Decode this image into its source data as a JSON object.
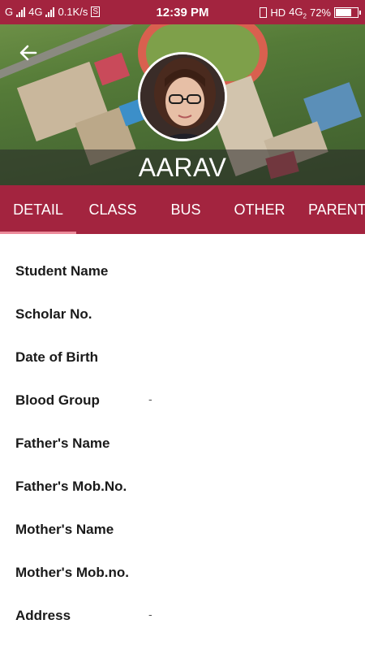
{
  "status_bar": {
    "carrier_left": "G",
    "network_left": "4G",
    "speed": "0.1K/s",
    "sim_badge": "S",
    "time": "12:39 PM",
    "hd": "HD",
    "network_right": "4G",
    "network_right_sub": "2",
    "battery_percent": "72%",
    "battery_level": 0.72
  },
  "header": {
    "student_name": "AARAV",
    "back_icon": "arrow-left-icon"
  },
  "tabs": [
    {
      "label": "DETAIL",
      "active": true
    },
    {
      "label": "CLASS",
      "active": false
    },
    {
      "label": "BUS",
      "active": false
    },
    {
      "label": "OTHER",
      "active": false
    },
    {
      "label": "PARENT",
      "active": false
    }
  ],
  "details": [
    {
      "label": "Student Name",
      "value": ""
    },
    {
      "label": "Scholar No.",
      "value": ""
    },
    {
      "label": "Date of Birth",
      "value": ""
    },
    {
      "label": "Blood Group",
      "value": "-"
    },
    {
      "label": "Father's Name",
      "value": ""
    },
    {
      "label": "Father's Mob.No.",
      "value": ""
    },
    {
      "label": "Mother's Name",
      "value": ""
    },
    {
      "label": "Mother's Mob.no.",
      "value": ""
    },
    {
      "label": "Address",
      "value": "-"
    }
  ],
  "colors": {
    "primary": "#a3243f",
    "tab_indicator": "#ec8a9a"
  }
}
